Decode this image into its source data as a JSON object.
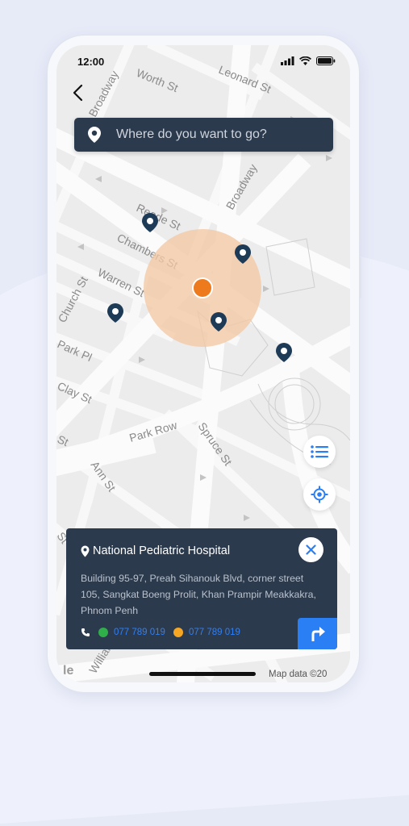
{
  "status_bar": {
    "time": "12:00"
  },
  "search": {
    "placeholder": "Where do you want to go?"
  },
  "map": {
    "streets": [
      "Worth St",
      "Leonard St",
      "Broadway",
      "Broadway",
      "Reade St",
      "Chambers St",
      "Warren St",
      "Church St",
      "Park Pl",
      "Clay St",
      "St",
      "Park Row",
      "Spruce St",
      "Ann St",
      "St",
      "William"
    ],
    "attribution": "Map data ©20"
  },
  "place_card": {
    "title": "National Pediatric Hospital",
    "address": "Building 95-97, Preah Sihanouk Blvd, corner street 105, Sangkat Boeng Prolit, Khan Prampir Meakkakra, Phnom Penh",
    "phone_1": "077 789 019",
    "phone_2": "077 789 019"
  },
  "colors": {
    "panel": "#2c3a4d",
    "accent_blue": "#2a7ff4",
    "marker": "#1d3b57",
    "current_location": "#ed7a1c",
    "phone_1_dot": "#2fae4a",
    "phone_2_dot": "#f5a623"
  },
  "icons": [
    "back-arrow-icon",
    "location-pin-icon",
    "list-icon",
    "locate-icon",
    "close-icon",
    "phone-icon",
    "turn-right-icon"
  ]
}
